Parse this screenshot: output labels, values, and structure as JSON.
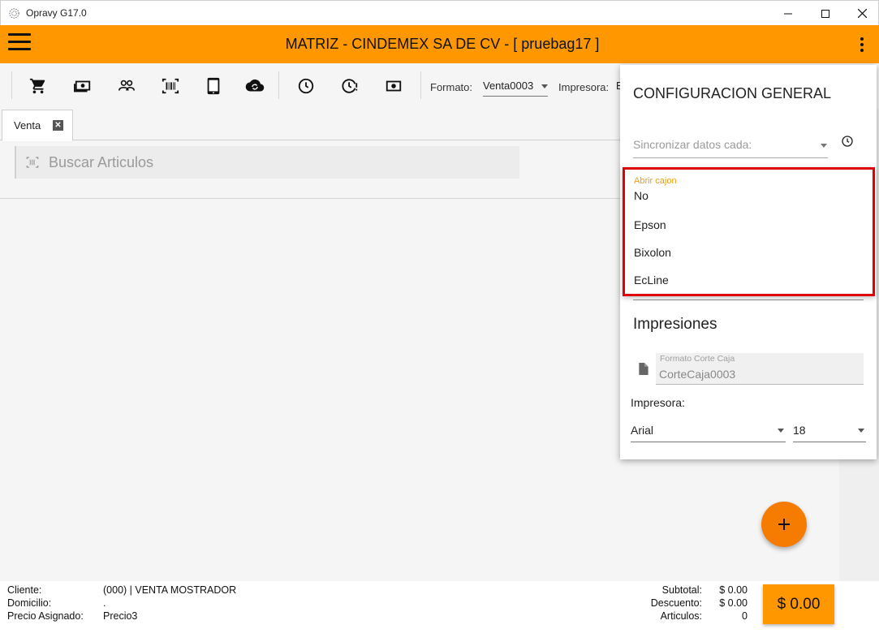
{
  "window": {
    "title": "Opravy G17.0"
  },
  "appbar": {
    "title": "MATRIZ - CINDEMEX SA DE CV - [ pruebag17 ]"
  },
  "toolbar": {
    "icons": [
      "cart-icon",
      "cash-icon",
      "people-icon",
      "barcode-icon",
      "tablet-icon",
      "cloud-sync-icon",
      "clock-icon",
      "clock-alert-icon",
      "money-icon"
    ],
    "formato_label": "Formato:",
    "formato_value": "Venta0003",
    "impresora_label": "Impresora:",
    "impresora_value": "E"
  },
  "tabs": [
    {
      "label": "Venta",
      "close": "✕"
    }
  ],
  "search": {
    "placeholder": "Buscar Articulos"
  },
  "fab": {
    "label": "+"
  },
  "footer": {
    "cliente_label": "Cliente:",
    "cliente_value": "(000) | VENTA MOSTRADOR",
    "domicilio_label": "Domicilio:",
    "domicilio_value": ".",
    "precio_label": "Precio Asignado:",
    "precio_value": "Precio3",
    "subtotal_label": "Subtotal:",
    "subtotal_value": "$ 0.00",
    "descuento_label": "Descuento:",
    "descuento_value": "$ 0.00",
    "articulos_label": "Articulos:",
    "articulos_value": "0",
    "total": "$ 0.00"
  },
  "config": {
    "title": "CONFIGURACION GENERAL",
    "sync_placeholder": "Sincronizar datos cada:",
    "cajon": {
      "label": "Abrir cajon",
      "options": [
        "No",
        "Epson",
        "Bixolon",
        "EcLine"
      ]
    },
    "impresiones_title": "Impresiones",
    "corte": {
      "label": "Formato Corte Caja",
      "value": "CorteCaja0003"
    },
    "impresora_label": "Impresora:",
    "font_value": "Arial",
    "size_value": "18"
  },
  "colors": {
    "accent": "#ff9800",
    "fab": "#f57c00",
    "highlight": "#e0000a",
    "label": "#f39c12"
  }
}
